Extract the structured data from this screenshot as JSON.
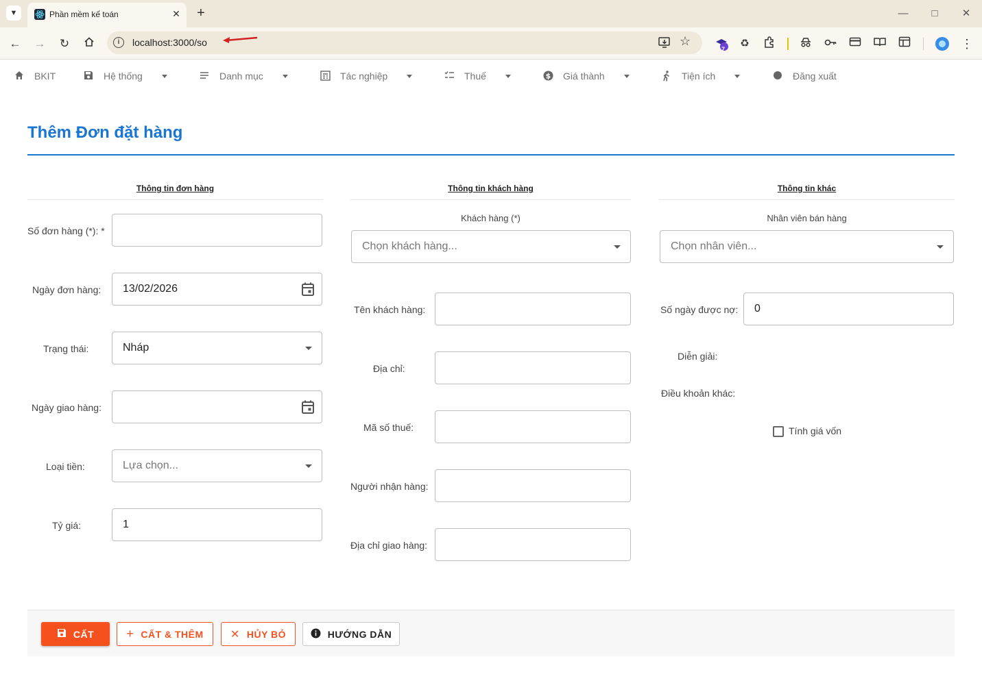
{
  "browser": {
    "tab_title": "Phần mềm kế toán",
    "url": "localhost:3000/so",
    "extension_badge": "7"
  },
  "nav": {
    "items": [
      {
        "label": "BKIT"
      },
      {
        "label": "Hệ thống"
      },
      {
        "label": "Danh mục"
      },
      {
        "label": "Tác nghiệp"
      },
      {
        "label": "Thuế"
      },
      {
        "label": "Giá thành"
      },
      {
        "label": "Tiện ích"
      },
      {
        "label": "Đăng xuất"
      }
    ]
  },
  "page": {
    "title": "Thêm Đơn đặt hàng"
  },
  "order_info": {
    "section_title": "Thông tin đơn hàng",
    "order_no_label": "Số đơn hàng (*): *",
    "order_no_value": "",
    "order_date_label": "Ngày đơn hàng:",
    "order_date_value": "13/02/2026",
    "status_label": "Trạng thái:",
    "status_value": "Nháp",
    "delivery_date_label": "Ngày giao hàng:",
    "delivery_date_value": "",
    "currency_label": "Loại tiền:",
    "currency_placeholder": "Lựa chọn...",
    "rate_label": "Tỷ giá:",
    "rate_value": "1"
  },
  "customer_info": {
    "section_title": "Thông tin khách hàng",
    "customer_label": "Khách hàng (*)",
    "customer_placeholder": "Chọn khách hàng...",
    "name_label": "Tên khách hàng:",
    "address_label": "Địa chỉ:",
    "tax_label": "Mã số thuế:",
    "receiver_label": "Người nhận hàng:",
    "delivery_address_label": "Địa chỉ giao hàng:"
  },
  "other_info": {
    "section_title": "Thông tin khác",
    "salesperson_label": "Nhân viên bán hàng",
    "salesperson_placeholder": "Chọn nhân viên...",
    "credit_days_label": "Số ngày được nợ:",
    "credit_days_value": "0",
    "description_label": "Diễn giải:",
    "other_terms_label": "Điều khoản khác:",
    "cost_checkbox_label": "Tính giá vốn"
  },
  "actions": {
    "save": "CẤT",
    "save_add": "CẤT & THÊM",
    "cancel": "HỦY BỎ",
    "help": "HƯỚNG DẪN"
  },
  "colors": {
    "accent": "#1976d2",
    "primary_button": "#f4511e"
  }
}
